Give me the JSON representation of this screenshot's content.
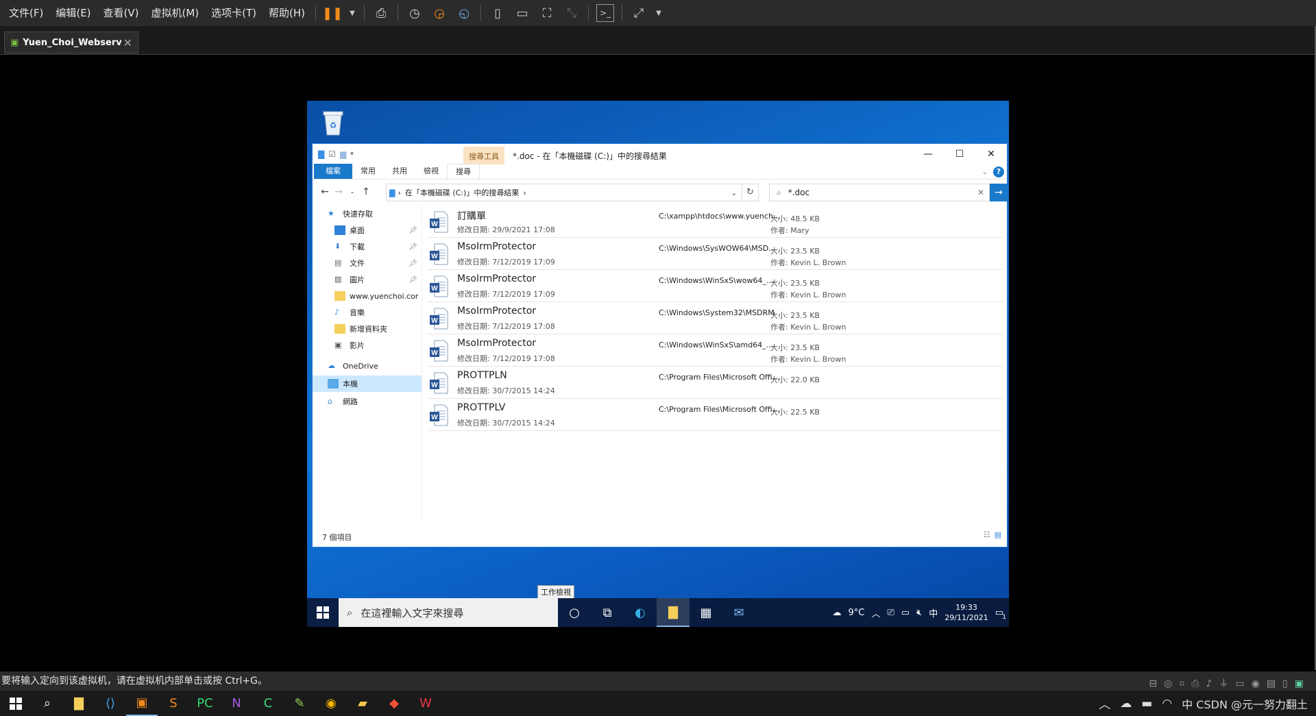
{
  "vm": {
    "menus": [
      "文件(F)",
      "编辑(E)",
      "查看(V)",
      "虚拟机(M)",
      "选项卡(T)",
      "帮助(H)"
    ],
    "tab_name": "Yuen_Choi_Webserv",
    "status_text": "要将输入定向到该虚拟机，请在虚拟机内部单击或按 Ctrl+G。"
  },
  "explorer": {
    "context_tab": "搜尋工具",
    "title": "*.doc - 在「本機磁碟 (C:)」中的搜尋結果",
    "ribbon_tabs": [
      "檔案",
      "常用",
      "共用",
      "檢視",
      "搜尋"
    ],
    "address": "在「本機磁碟 (C:)」中的搜尋結果",
    "search_value": "*.doc",
    "nav": {
      "quick_access": "快速存取",
      "items": [
        {
          "label": "桌面",
          "pinned": true
        },
        {
          "label": "下載",
          "pinned": true
        },
        {
          "label": "文件",
          "pinned": true
        },
        {
          "label": "圖片",
          "pinned": true
        },
        {
          "label": "www.yuenchoi.cor",
          "pinned": false
        },
        {
          "label": "音樂",
          "pinned": false
        },
        {
          "label": "新增資料夾",
          "pinned": false
        },
        {
          "label": "影片",
          "pinned": false
        }
      ],
      "onedrive": "OneDrive",
      "this_pc": "本機",
      "network": "網路"
    },
    "files": [
      {
        "name": "訂購單",
        "date": "修改日期: 29/9/2021 17:08",
        "path": "C:\\xampp\\htdocs\\www.yuench...",
        "size": "大小: 48.5 KB",
        "author": "作者: Mary"
      },
      {
        "name": "MsoIrmProtector",
        "date": "修改日期: 7/12/2019 17:09",
        "path": "C:\\Windows\\SysWOW64\\MSD...",
        "size": "大小: 23.5 KB",
        "author": "作者: Kevin L. Brown"
      },
      {
        "name": "MsoIrmProtector",
        "date": "修改日期: 7/12/2019 17:09",
        "path": "C:\\Windows\\WinSxS\\wow64_...",
        "size": "大小: 23.5 KB",
        "author": "作者: Kevin L. Brown"
      },
      {
        "name": "MsoIrmProtector",
        "date": "修改日期: 7/12/2019 17:08",
        "path": "C:\\Windows\\System32\\MSDRM",
        "size": "大小: 23.5 KB",
        "author": "作者: Kevin L. Brown"
      },
      {
        "name": "MsoIrmProtector",
        "date": "修改日期: 7/12/2019 17:08",
        "path": "C:\\Windows\\WinSxS\\amd64_...",
        "size": "大小: 23.5 KB",
        "author": "作者: Kevin L. Brown"
      },
      {
        "name": "PROTTPLN",
        "date": "修改日期: 30/7/2015 14:24",
        "path": "C:\\Program Files\\Microsoft Offi...",
        "size": "大小: 22.0 KB",
        "author": ""
      },
      {
        "name": "PROTTPLV",
        "date": "修改日期: 30/7/2015 14:24",
        "path": "C:\\Program Files\\Microsoft Offi...",
        "size": "大小: 22.5 KB",
        "author": ""
      }
    ],
    "status": "7 個項目"
  },
  "guest_taskbar": {
    "search_placeholder": "在這裡輸入文字來搜尋",
    "tooltip": "工作檢視",
    "weather": "9°C",
    "ime": "中",
    "time": "19:33",
    "date": "29/11/2021",
    "notif_count": "1"
  },
  "host_tray": {
    "text": "中 CSDN @元一努力翻土"
  },
  "colors": {
    "accent": "#1979ca",
    "vm_chrome": "#2b2b2b",
    "pause_icon": "#f28a1a"
  }
}
